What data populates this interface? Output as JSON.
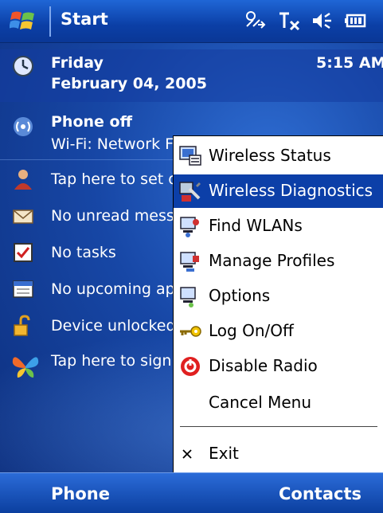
{
  "titlebar": {
    "start_label": "Start",
    "icons": [
      "connectivity-icon",
      "signal-off-icon",
      "speaker-icon",
      "battery-icon"
    ]
  },
  "today": {
    "date": {
      "day": "Friday",
      "date": "February 04, 2005",
      "time": "5:15 AM"
    },
    "phone": {
      "status": "Phone off",
      "wifi": "Wi-Fi: Network Found"
    },
    "owner": "Tap here to set owner information",
    "messages": "No unread messages",
    "tasks": "No tasks",
    "calendar": "No upcoming appointments",
    "lock": "Device unlocked",
    "signin": "Tap here to sign in"
  },
  "menu": {
    "items": [
      {
        "label": "Wireless Status",
        "icon": "wireless-status-icon"
      },
      {
        "label": "Wireless Diagnostics",
        "icon": "wireless-diagnostics-icon",
        "selected": true
      },
      {
        "label": "Find WLANs",
        "icon": "find-wlans-icon"
      },
      {
        "label": "Manage Profiles",
        "icon": "manage-profiles-icon"
      },
      {
        "label": "Options",
        "icon": "options-icon"
      },
      {
        "label": "Log On/Off",
        "icon": "key-icon"
      },
      {
        "label": "Disable Radio",
        "icon": "power-icon"
      },
      {
        "label": "Cancel Menu",
        "icon": ""
      },
      {
        "label": "Exit",
        "icon": "close-icon"
      }
    ]
  },
  "softkeys": {
    "left": "Phone",
    "right": "Contacts"
  },
  "colors": {
    "selection": "#0c3fa8",
    "titlebar": "#1f66d6",
    "background": "#1747a6"
  }
}
